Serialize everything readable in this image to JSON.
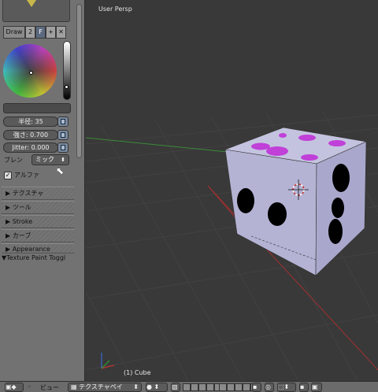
{
  "tool_panel": {
    "brush_buttons": {
      "draw": "Draw",
      "count": "2",
      "fake_user": "F",
      "add": "+",
      "delete": "✕"
    },
    "radius_label": "半径: 35",
    "strength_label": "強さ: 0.700",
    "jitter_label": "Jitter: 0.000",
    "blend_label": "ブレン",
    "blend_value": "ミック",
    "alpha_label": "アルファ",
    "alpha_checked": true,
    "sections": [
      "テクスチャ",
      "ツール",
      "Stroke",
      "カーブ",
      "Appearance"
    ],
    "open_section": "Texture Paint Toggl"
  },
  "viewport": {
    "view_label": "User Persp",
    "object_label": "(1) Cube",
    "cube_colors": {
      "face": "#b9b8d8",
      "top_spots": "#c040d8",
      "side_spots": "#000000"
    }
  },
  "header": {
    "view_menu": "ビュー",
    "mode_value": "テクスチャペイ"
  },
  "colors": {
    "panel_bg": "#727272",
    "viewport_bg": "#393939",
    "axis_red": "#a03030",
    "axis_green": "#3a8a3a"
  }
}
